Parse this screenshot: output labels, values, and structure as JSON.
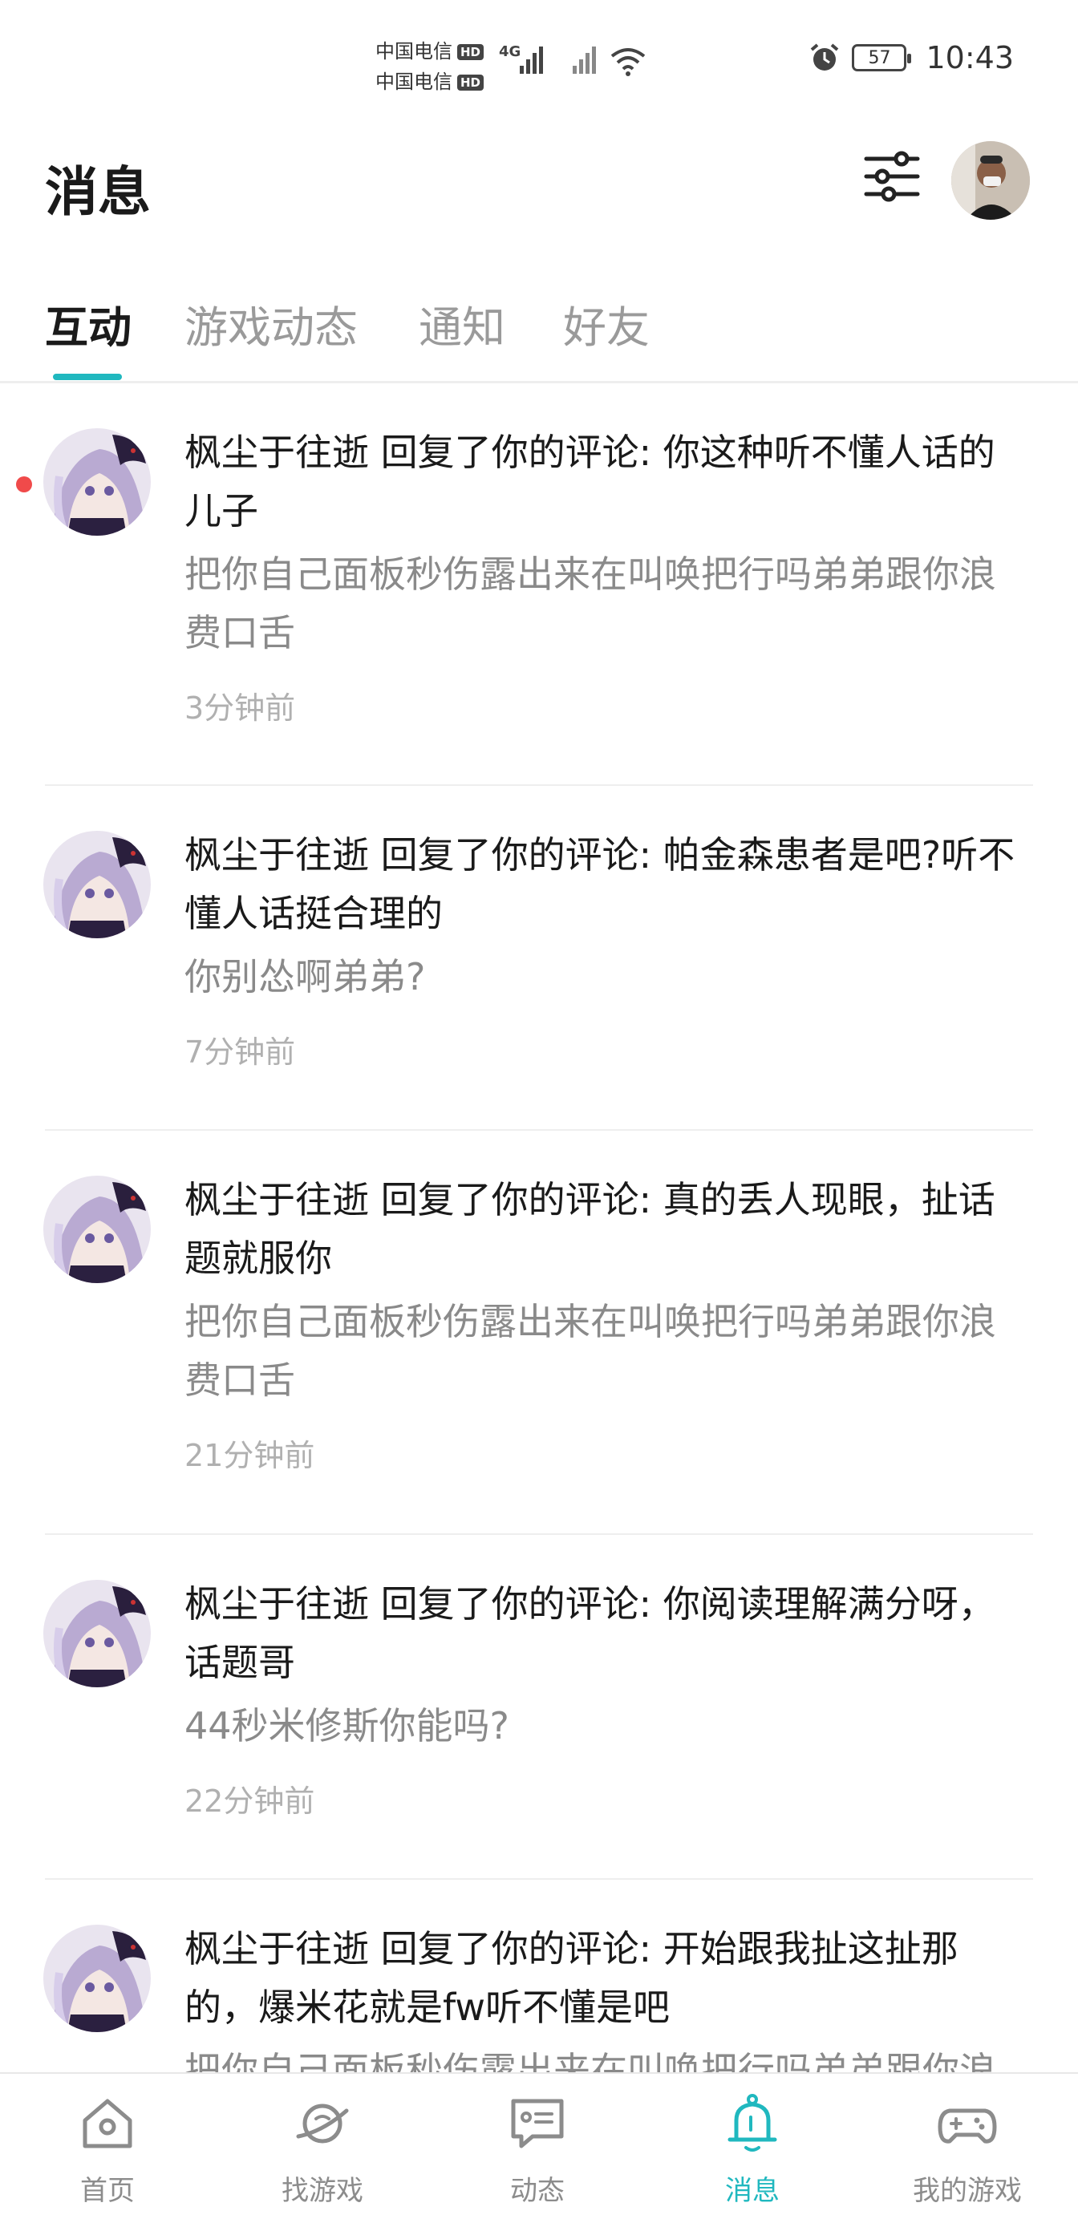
{
  "status_bar": {
    "carrier_1": "中国电信",
    "carrier_2": "中国电信",
    "hd_badge": "HD",
    "network": "4G",
    "battery": "57",
    "time": "10:43"
  },
  "header": {
    "title": "消息",
    "filter_icon": "sliders-icon",
    "avatar_icon": "user-avatar"
  },
  "tabs": [
    {
      "label": "互动",
      "active": true
    },
    {
      "label": "游戏动态",
      "active": false
    },
    {
      "label": "通知",
      "active": false
    },
    {
      "label": "好友",
      "active": false
    }
  ],
  "messages": [
    {
      "title": "枫尘于往逝 回复了你的评论: 你这种听不懂人话的儿子",
      "content": "把你自己面板秒伤露出来在叫唤把行吗弟弟跟你浪费口舌",
      "time": "3分钟前",
      "unread": true
    },
    {
      "title": "枫尘于往逝 回复了你的评论: 帕金森患者是吧?听不懂人话挺合理的",
      "content": "你别怂啊弟弟?",
      "time": "7分钟前",
      "unread": false
    },
    {
      "title": "枫尘于往逝 回复了你的评论: 真的丢人现眼，扯话题就服你",
      "content": "把你自己面板秒伤露出来在叫唤把行吗弟弟跟你浪费口舌",
      "time": "21分钟前",
      "unread": false
    },
    {
      "title": "枫尘于往逝 回复了你的评论: 你阅读理解满分呀，话题哥",
      "content": "44秒米修斯你能吗?",
      "time": "22分钟前",
      "unread": false
    },
    {
      "title": "枫尘于往逝 回复了你的评论: 开始跟我扯这扯那的，爆米花就是fw听不懂是吧",
      "content": "把你自己面板秒伤露出来在叫唤把行吗弟弟跟你浪费口舌",
      "time": "",
      "unread": false
    }
  ],
  "bottom_nav": [
    {
      "label": "首页",
      "icon": "home-icon",
      "active": false
    },
    {
      "label": "找游戏",
      "icon": "planet-icon",
      "active": false
    },
    {
      "label": "动态",
      "icon": "feed-icon",
      "active": false
    },
    {
      "label": "消息",
      "icon": "bell-icon",
      "active": true
    },
    {
      "label": "我的游戏",
      "icon": "gamepad-icon",
      "active": false
    }
  ],
  "colors": {
    "accent": "#20b8bf",
    "unread_dot": "#f04a4a",
    "muted_text": "#8a8a8a"
  }
}
